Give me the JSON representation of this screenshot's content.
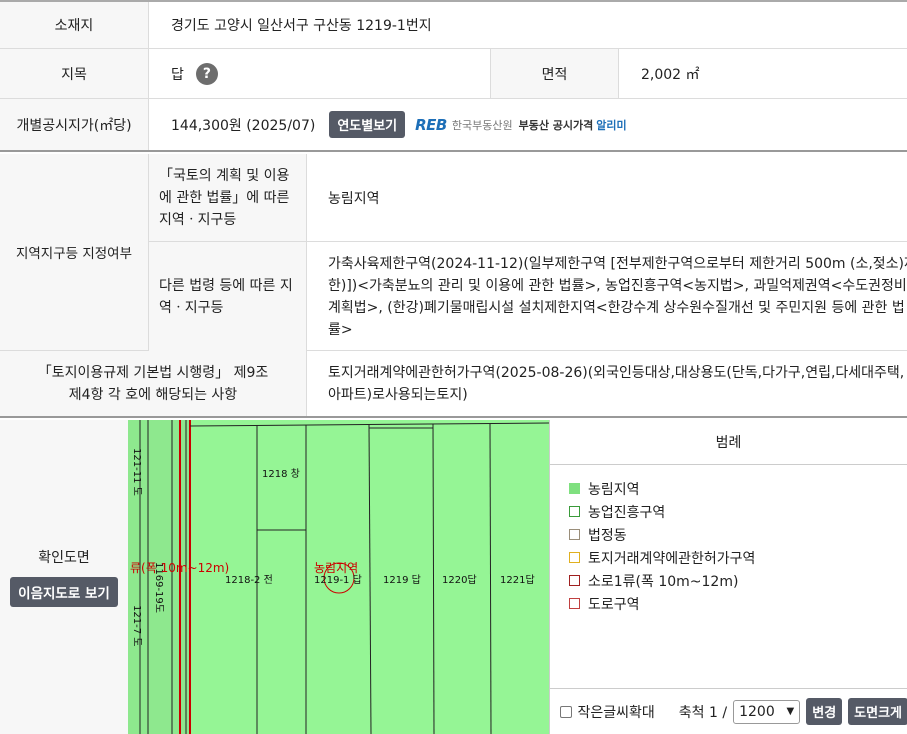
{
  "location": {
    "label": "소재지",
    "value": "경기도 고양시 일산서구 구산동 1219-1번지"
  },
  "jimok": {
    "label": "지목",
    "value": "답",
    "help_icon": "?"
  },
  "area": {
    "label": "면적",
    "value": "2,002 ㎡"
  },
  "price": {
    "label": "개별공시지가(㎡당)",
    "value": "144,300원 (2025/07)",
    "button": "연도별보기",
    "reb_logo": "REB",
    "reb_org": "한국부동산원",
    "reb_service": "부동산 공시가격",
    "reb_alimi": "알리미"
  },
  "zoning": {
    "label": "지역지구등 지정여부",
    "national_label": "「국토의 계획 및 이용에 관한 법률」에 따른 지역ㆍ지구등",
    "national_value": "농림지역",
    "other_label": "다른 법령 등에 따른 지역ㆍ지구등",
    "other_value": "가축사육제한구역(2024-11-12)(일부제한구역 [전부제한구역으로부터 제한거리 500m (소,젖소)제한)])<가축분뇨의 관리 및 이용에 관한 법률>, 농업진흥구역<농지법>, 과밀억제권역<수도권정비계획법>, (한강)폐기물매립시설 설치제한지역<한강수계 상수원수질개선 및 주민지원 등에 관한 법률>"
  },
  "regulation": {
    "label": "「토지이용규제 기본법 시행령」 제9조 제4항 각 호에 해당되는 사항",
    "value": "토지거래계약에관한허가구역(2025-08-26)(외국인등대상,대상용도(단독,다가구,연립,다세대주택,아파트)로사용되는토지)"
  },
  "map": {
    "label": "확인도면",
    "button": "이음지도로 보기",
    "parcels": [
      "1218 창",
      "1218-2 전",
      "1219-1 답",
      "1219 답",
      "1220답",
      "1221답",
      "1169-19도",
      "121-7 도",
      "121-11 도"
    ],
    "road_label": "류(폭 10m~12m)",
    "zone_label": "농림지역"
  },
  "legend": {
    "title": "범례",
    "items": [
      {
        "label": "농림지역",
        "color": "#7fe07f",
        "filled": true
      },
      {
        "label": "농업진흥구역",
        "color": "#3a9a3a",
        "filled": false
      },
      {
        "label": "법정동",
        "color": "#9a8e7a",
        "filled": false
      },
      {
        "label": "토지거래계약에관한허가구역",
        "color": "#e0b020",
        "filled": false
      },
      {
        "label": "소로1류(폭 10m~12m)",
        "color": "#a02020",
        "filled": false
      },
      {
        "label": "도로구역",
        "color": "#c04040",
        "filled": false
      }
    ],
    "small_text_label": "작은글씨확대",
    "scale_label": "축척 1 /",
    "scale_value": "1200",
    "change_button": "변경",
    "print_button": "도면크게"
  }
}
